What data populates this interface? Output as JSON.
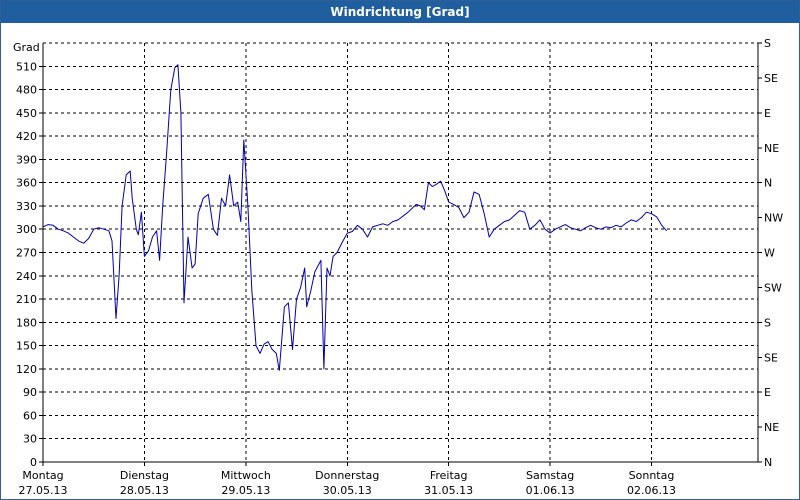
{
  "window": {
    "title": "Windrichtung [Grad]"
  },
  "chart_data": {
    "type": "line",
    "title": "Windrichtung [Grad]",
    "ylabel": "Grad",
    "ylim": [
      0,
      540
    ],
    "y_ticks": [
      0,
      30,
      60,
      90,
      120,
      150,
      180,
      210,
      240,
      270,
      300,
      330,
      360,
      390,
      420,
      450,
      480,
      510
    ],
    "y_right_ticks": [
      {
        "value": 0,
        "label": "N"
      },
      {
        "value": 45,
        "label": "NE"
      },
      {
        "value": 90,
        "label": "E"
      },
      {
        "value": 135,
        "label": "SE"
      },
      {
        "value": 180,
        "label": "S"
      },
      {
        "value": 225,
        "label": "SW"
      },
      {
        "value": 270,
        "label": "W"
      },
      {
        "value": 315,
        "label": "NW"
      },
      {
        "value": 360,
        "label": "N"
      },
      {
        "value": 405,
        "label": "NE"
      },
      {
        "value": 450,
        "label": "E"
      },
      {
        "value": 495,
        "label": "SE"
      },
      {
        "value": 540,
        "label": "S"
      }
    ],
    "x_range": [
      0,
      7.05
    ],
    "x_ticks": [
      {
        "day": "Montag",
        "date": "27.05.13",
        "x": 0
      },
      {
        "day": "Dienstag",
        "date": "28.05.13",
        "x": 1
      },
      {
        "day": "Mittwoch",
        "date": "29.05.13",
        "x": 2
      },
      {
        "day": "Donnerstag",
        "date": "30.05.13",
        "x": 3
      },
      {
        "day": "Freitag",
        "date": "31.05.13",
        "x": 4
      },
      {
        "day": "Samstag",
        "date": "01.06.13",
        "x": 5
      },
      {
        "day": "Sonntag",
        "date": "02.06.13",
        "x": 6
      }
    ],
    "grid": true,
    "series": [
      {
        "color": "#0000b0",
        "points": [
          [
            0.0,
            303
          ],
          [
            0.05,
            306
          ],
          [
            0.1,
            305
          ],
          [
            0.15,
            300
          ],
          [
            0.2,
            298
          ],
          [
            0.25,
            295
          ],
          [
            0.3,
            290
          ],
          [
            0.35,
            285
          ],
          [
            0.4,
            282
          ],
          [
            0.45,
            288
          ],
          [
            0.5,
            300
          ],
          [
            0.55,
            302
          ],
          [
            0.6,
            300
          ],
          [
            0.65,
            298
          ],
          [
            0.68,
            285
          ],
          [
            0.72,
            185
          ],
          [
            0.75,
            240
          ],
          [
            0.78,
            330
          ],
          [
            0.82,
            370
          ],
          [
            0.86,
            375
          ],
          [
            0.88,
            340
          ],
          [
            0.92,
            300
          ],
          [
            0.94,
            293
          ],
          [
            0.97,
            322
          ],
          [
            1.0,
            265
          ],
          [
            1.04,
            272
          ],
          [
            1.08,
            290
          ],
          [
            1.12,
            298
          ],
          [
            1.15,
            260
          ],
          [
            1.18,
            330
          ],
          [
            1.22,
            400
          ],
          [
            1.26,
            480
          ],
          [
            1.3,
            508
          ],
          [
            1.33,
            512
          ],
          [
            1.36,
            450
          ],
          [
            1.39,
            205
          ],
          [
            1.43,
            290
          ],
          [
            1.47,
            250
          ],
          [
            1.5,
            255
          ],
          [
            1.53,
            320
          ],
          [
            1.58,
            340
          ],
          [
            1.63,
            345
          ],
          [
            1.68,
            300
          ],
          [
            1.72,
            292
          ],
          [
            1.76,
            340
          ],
          [
            1.8,
            330
          ],
          [
            1.84,
            370
          ],
          [
            1.88,
            330
          ],
          [
            1.92,
            335
          ],
          [
            1.95,
            310
          ],
          [
            1.98,
            415
          ],
          [
            2.02,
            330
          ],
          [
            2.06,
            220
          ],
          [
            2.1,
            150
          ],
          [
            2.14,
            140
          ],
          [
            2.18,
            152
          ],
          [
            2.22,
            155
          ],
          [
            2.26,
            145
          ],
          [
            2.3,
            140
          ],
          [
            2.33,
            118
          ],
          [
            2.38,
            200
          ],
          [
            2.42,
            205
          ],
          [
            2.46,
            145
          ],
          [
            2.5,
            210
          ],
          [
            2.54,
            225
          ],
          [
            2.58,
            250
          ],
          [
            2.6,
            200
          ],
          [
            2.64,
            220
          ],
          [
            2.68,
            245
          ],
          [
            2.72,
            255
          ],
          [
            2.74,
            260
          ],
          [
            2.77,
            120
          ],
          [
            2.8,
            250
          ],
          [
            2.83,
            240
          ],
          [
            2.86,
            265
          ],
          [
            2.9,
            270
          ],
          [
            2.95,
            283
          ],
          [
            3.0,
            295
          ],
          [
            3.05,
            297
          ],
          [
            3.1,
            305
          ],
          [
            3.15,
            300
          ],
          [
            3.2,
            290
          ],
          [
            3.25,
            303
          ],
          [
            3.3,
            305
          ],
          [
            3.35,
            307
          ],
          [
            3.4,
            305
          ],
          [
            3.45,
            310
          ],
          [
            3.5,
            312
          ],
          [
            3.6,
            322
          ],
          [
            3.68,
            332
          ],
          [
            3.72,
            330
          ],
          [
            3.76,
            325
          ],
          [
            3.8,
            360
          ],
          [
            3.84,
            355
          ],
          [
            3.88,
            358
          ],
          [
            3.92,
            362
          ],
          [
            3.96,
            350
          ],
          [
            4.0,
            335
          ],
          [
            4.05,
            332
          ],
          [
            4.1,
            328
          ],
          [
            4.15,
            315
          ],
          [
            4.2,
            322
          ],
          [
            4.25,
            348
          ],
          [
            4.3,
            345
          ],
          [
            4.35,
            320
          ],
          [
            4.4,
            290
          ],
          [
            4.45,
            300
          ],
          [
            4.5,
            305
          ],
          [
            4.55,
            310
          ],
          [
            4.6,
            312
          ],
          [
            4.65,
            318
          ],
          [
            4.7,
            324
          ],
          [
            4.75,
            322
          ],
          [
            4.8,
            300
          ],
          [
            4.85,
            305
          ],
          [
            4.9,
            312
          ],
          [
            4.95,
            300
          ],
          [
            5.0,
            295
          ],
          [
            5.05,
            300
          ],
          [
            5.1,
            303
          ],
          [
            5.15,
            306
          ],
          [
            5.2,
            302
          ],
          [
            5.25,
            300
          ],
          [
            5.3,
            298
          ],
          [
            5.35,
            302
          ],
          [
            5.4,
            305
          ],
          [
            5.45,
            302
          ],
          [
            5.5,
            300
          ],
          [
            5.55,
            303
          ],
          [
            5.6,
            302
          ],
          [
            5.65,
            305
          ],
          [
            5.7,
            303
          ],
          [
            5.75,
            308
          ],
          [
            5.8,
            312
          ],
          [
            5.85,
            310
          ],
          [
            5.9,
            315
          ],
          [
            5.95,
            322
          ],
          [
            6.0,
            320
          ],
          [
            6.05,
            316
          ],
          [
            6.1,
            305
          ],
          [
            6.15,
            298
          ]
        ]
      }
    ]
  }
}
